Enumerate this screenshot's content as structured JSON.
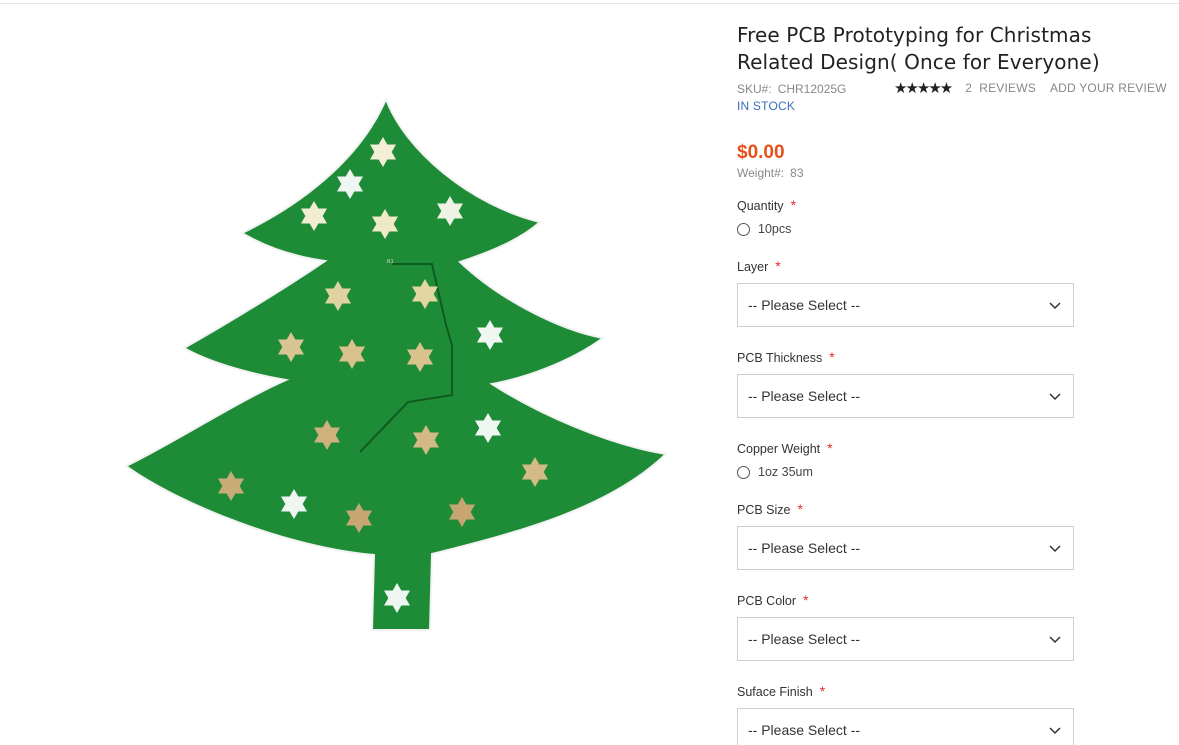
{
  "product": {
    "title_line1": "Free PCB Prototyping for Christmas",
    "title_line2": "Related Design( Once for Everyone)",
    "sku_label": "SKU#:",
    "sku_value": "CHR12025G",
    "stars": "★★★★★",
    "reviews_count": "2",
    "reviews_label": "REVIEWS",
    "add_review": "ADD YOUR REVIEW",
    "stock": "IN STOCK",
    "price": "$0.00",
    "weight_label": "Weight#:",
    "weight_value": "83",
    "rating": 5
  },
  "options": {
    "quantity": {
      "label": "Quantity",
      "required": "*",
      "choice": "10pcs"
    },
    "layer": {
      "label": "Layer",
      "required": "*",
      "value": "-- Please Select --"
    },
    "thickness": {
      "label": "PCB Thickness",
      "required": "*",
      "value": "-- Please Select --"
    },
    "copper": {
      "label": "Copper Weight",
      "required": "*",
      "choice": "1oz 35um"
    },
    "size": {
      "label": "PCB Size",
      "required": "*",
      "value": "-- Please Select --"
    },
    "color": {
      "label": "PCB Color",
      "required": "*",
      "value": "-- Please Select --"
    },
    "finish": {
      "label": "Suface Finish",
      "required": "*",
      "value": "-- Please Select --"
    }
  },
  "colors": {
    "price": "#e8501b",
    "stock": "#3a6fb8",
    "required": "#e02b27",
    "pcb_green": "#1e8c36"
  }
}
